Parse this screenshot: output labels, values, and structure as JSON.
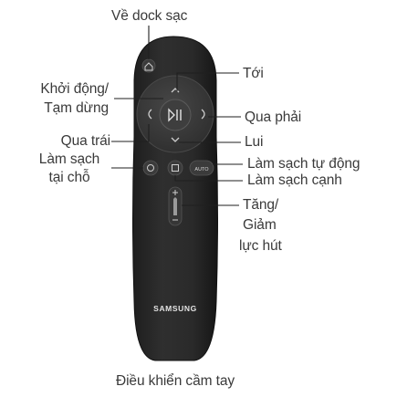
{
  "caption": "Điều khiển cầm tay",
  "remote": {
    "brand": "SAMSUNG",
    "auto_button": "AUTO",
    "body_color": "#2a2a2a",
    "button_color": "#3d3d3d",
    "leader_color": "#1f1f1f"
  },
  "labels": {
    "dock": "Về dock sạc",
    "forward": "Tới",
    "start_pause_1": "Khởi động/",
    "start_pause_2": "Tạm dừng",
    "turn_right": "Qua phải",
    "turn_left": "Qua trái",
    "back": "Lui",
    "spot_clean_1": "Làm sạch",
    "spot_clean_2": "tại chỗ",
    "auto_clean": "Làm sạch tự động",
    "edge_clean": "Làm sạch cạnh",
    "suction_1": "Tăng/",
    "suction_2": "Giảm",
    "suction_3": "lực hút"
  }
}
